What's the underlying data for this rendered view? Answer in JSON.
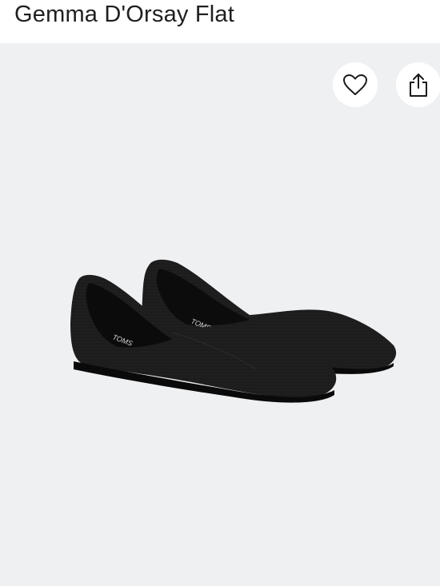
{
  "product": {
    "title": "Gemma D'Orsay Flat"
  },
  "actions": {
    "favorite_icon": "heart-icon",
    "share_icon": "share-icon"
  },
  "image": {
    "subject": "black-knit-dorsay-flats",
    "logo": "TOMS",
    "background": "#eff0f2"
  }
}
